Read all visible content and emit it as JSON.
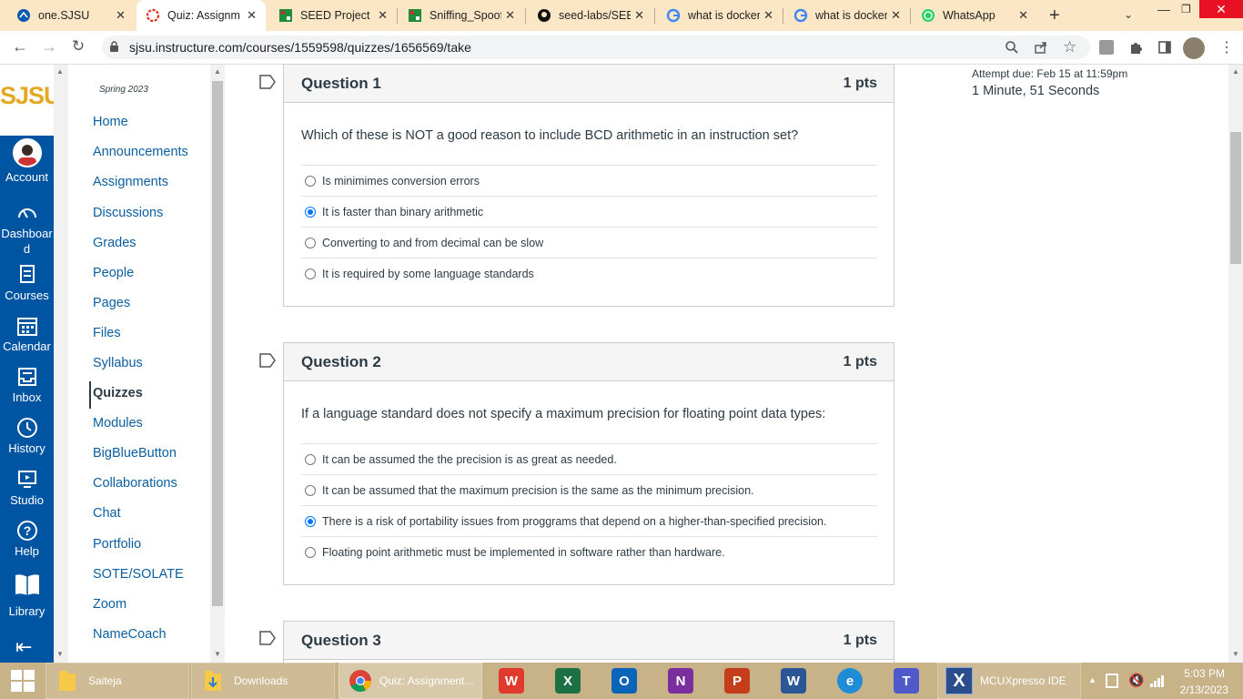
{
  "browser": {
    "tabs": [
      {
        "title": "one.SJSU",
        "icon": "sjsu-icon"
      },
      {
        "title": "Quiz: Assignm",
        "icon": "canvas-icon",
        "active": true
      },
      {
        "title": "SEED Project",
        "icon": "seed-icon"
      },
      {
        "title": "Sniffing_Spoof",
        "icon": "seed-icon"
      },
      {
        "title": "seed-labs/SEE",
        "icon": "github-icon"
      },
      {
        "title": "what is docker",
        "icon": "google-icon"
      },
      {
        "title": "what is docker",
        "icon": "google-icon"
      },
      {
        "title": "WhatsApp",
        "icon": "whatsapp-icon"
      }
    ],
    "url": "sjsu.instructure.com/courses/1559598/quizzes/1656569/take"
  },
  "global_nav": {
    "logo": "SJSU",
    "items": [
      {
        "label": "Account",
        "icon": "avatar-icon"
      },
      {
        "label": "Dashboard",
        "icon": "dashboard-icon"
      },
      {
        "label": "Courses",
        "icon": "courses-icon"
      },
      {
        "label": "Calendar",
        "icon": "calendar-icon"
      },
      {
        "label": "Inbox",
        "icon": "inbox-icon"
      },
      {
        "label": "History",
        "icon": "history-icon"
      },
      {
        "label": "Studio",
        "icon": "studio-icon"
      },
      {
        "label": "Help",
        "icon": "help-icon"
      },
      {
        "label": "Library",
        "icon": "library-icon"
      }
    ]
  },
  "course_nav": {
    "term": "Spring 2023",
    "items": [
      "Home",
      "Announcements",
      "Assignments",
      "Discussions",
      "Grades",
      "People",
      "Pages",
      "Files",
      "Syllabus",
      "Quizzes",
      "Modules",
      "BigBlueButton",
      "Collaborations",
      "Chat",
      "Portfolio",
      "SOTE/SOLATE",
      "Zoom",
      "NameCoach"
    ],
    "active": "Quizzes"
  },
  "quiz": {
    "attempt_due": "Attempt due: Feb 15 at 11:59pm",
    "time_elapsed": "1 Minute, 51 Seconds",
    "questions": [
      {
        "title": "Question 1",
        "points": "1 pts",
        "text": "Which of these is NOT a good reason to include BCD arithmetic in an instruction set?",
        "answers": [
          "Is minimimes conversion errors",
          "It is faster than binary arithmetic",
          "Converting to and from decimal can be slow",
          "It is required by some language standards"
        ],
        "selected": 1
      },
      {
        "title": "Question 2",
        "points": "1 pts",
        "text": "If a language standard does not specify a maximum precision for floating point data types:",
        "answers": [
          "It can be assumed the the precision is as great as needed.",
          "It can be assumed that the maximum precision is the same as the minimum precision.",
          "There is a risk of portability issues from proggrams that depend on a higher-than-specified precision.",
          "Floating point arithmetic must be implemented in software rather than hardware."
        ],
        "selected": 2
      },
      {
        "title": "Question 3",
        "points": "1 pts"
      }
    ]
  },
  "taskbar": {
    "apps": [
      {
        "label": "Saiteja",
        "icon": "folder-icon"
      },
      {
        "label": "Downloads",
        "icon": "folder-download-icon"
      },
      {
        "label": "Quiz: Assignment...",
        "icon": "chrome-icon"
      },
      {
        "label": "MCUXpresso IDE",
        "icon": "mcuxpresso-icon"
      }
    ],
    "pinned": [
      {
        "glyph": "W",
        "icon": "wps-icon",
        "color": "#e03a2e"
      },
      {
        "glyph": "X",
        "icon": "excel-icon",
        "color": "#1d7044"
      },
      {
        "glyph": "O",
        "icon": "outlook-icon",
        "color": "#0a64b8"
      },
      {
        "glyph": "N",
        "icon": "onenote-icon",
        "color": "#7b2f9c"
      },
      {
        "glyph": "P",
        "icon": "powerpoint-icon",
        "color": "#c43e1c"
      },
      {
        "glyph": "W",
        "icon": "word-icon",
        "color": "#2b5797"
      },
      {
        "glyph": "e",
        "icon": "edge-icon",
        "color": "#1f8dd6"
      },
      {
        "glyph": "T",
        "icon": "teams-icon",
        "color": "#5059c9"
      }
    ],
    "time": "5:03 PM",
    "date": "2/13/2023"
  }
}
